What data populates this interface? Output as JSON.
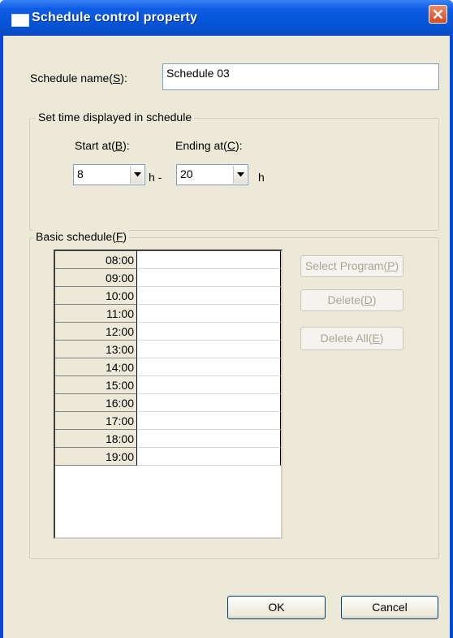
{
  "window": {
    "title": "Schedule control property",
    "icon": "window-icon",
    "close_icon": "close-x-icon"
  },
  "schedule_name": {
    "label_prefix": "Schedule name(",
    "label_key": "S",
    "label_suffix": "):",
    "value": "Schedule 03"
  },
  "time_group": {
    "legend": "Set time displayed in schedule",
    "start": {
      "label_prefix": "Start at(",
      "label_key": "B",
      "label_suffix": "):",
      "value": "8",
      "unit": "h -"
    },
    "end": {
      "label_prefix": "Ending at(",
      "label_key": "C",
      "label_suffix": "):",
      "value": "20",
      "unit": "h"
    }
  },
  "basic_schedule": {
    "legend_prefix": "Basic schedule(",
    "legend_key": "F",
    "legend_suffix": ")",
    "rows": [
      {
        "time": "08:00",
        "program": ""
      },
      {
        "time": "09:00",
        "program": ""
      },
      {
        "time": "10:00",
        "program": ""
      },
      {
        "time": "11:00",
        "program": ""
      },
      {
        "time": "12:00",
        "program": ""
      },
      {
        "time": "13:00",
        "program": ""
      },
      {
        "time": "14:00",
        "program": ""
      },
      {
        "time": "15:00",
        "program": ""
      },
      {
        "time": "16:00",
        "program": ""
      },
      {
        "time": "17:00",
        "program": ""
      },
      {
        "time": "18:00",
        "program": ""
      },
      {
        "time": "19:00",
        "program": ""
      }
    ],
    "select_program": {
      "prefix": "Select Program(",
      "key": "P",
      "suffix": ")"
    },
    "delete": {
      "prefix": "Delete(",
      "key": "D",
      "suffix": ")"
    },
    "delete_all": {
      "prefix": "Delete All(",
      "key": "E",
      "suffix": ")"
    }
  },
  "footer": {
    "ok_label": "OK",
    "cancel_label": "Cancel"
  },
  "colors": {
    "titlebar": "#0556d8",
    "dialog_face": "#ece9d8",
    "close_button": "#d34b22",
    "disabled_text": "#a9a793"
  }
}
